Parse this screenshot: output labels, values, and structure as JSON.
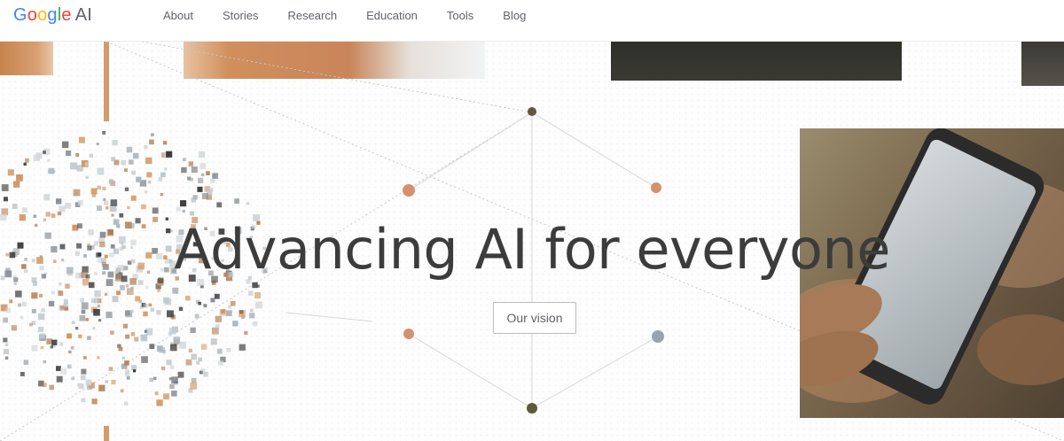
{
  "header": {
    "logo": {
      "google": "Google",
      "ai": "AI"
    },
    "nav": [
      {
        "label": "About"
      },
      {
        "label": "Stories"
      },
      {
        "label": "Research"
      },
      {
        "label": "Education"
      },
      {
        "label": "Tools"
      },
      {
        "label": "Blog"
      }
    ]
  },
  "hero": {
    "headline": "Advancing AI for everyone",
    "cta_label": "Our vision"
  },
  "colors": {
    "accent_orange": "#d4916b",
    "node_dark": "#5d5a3c",
    "node_gray": "#9aa3ad",
    "headline": "#3c3c3c"
  }
}
